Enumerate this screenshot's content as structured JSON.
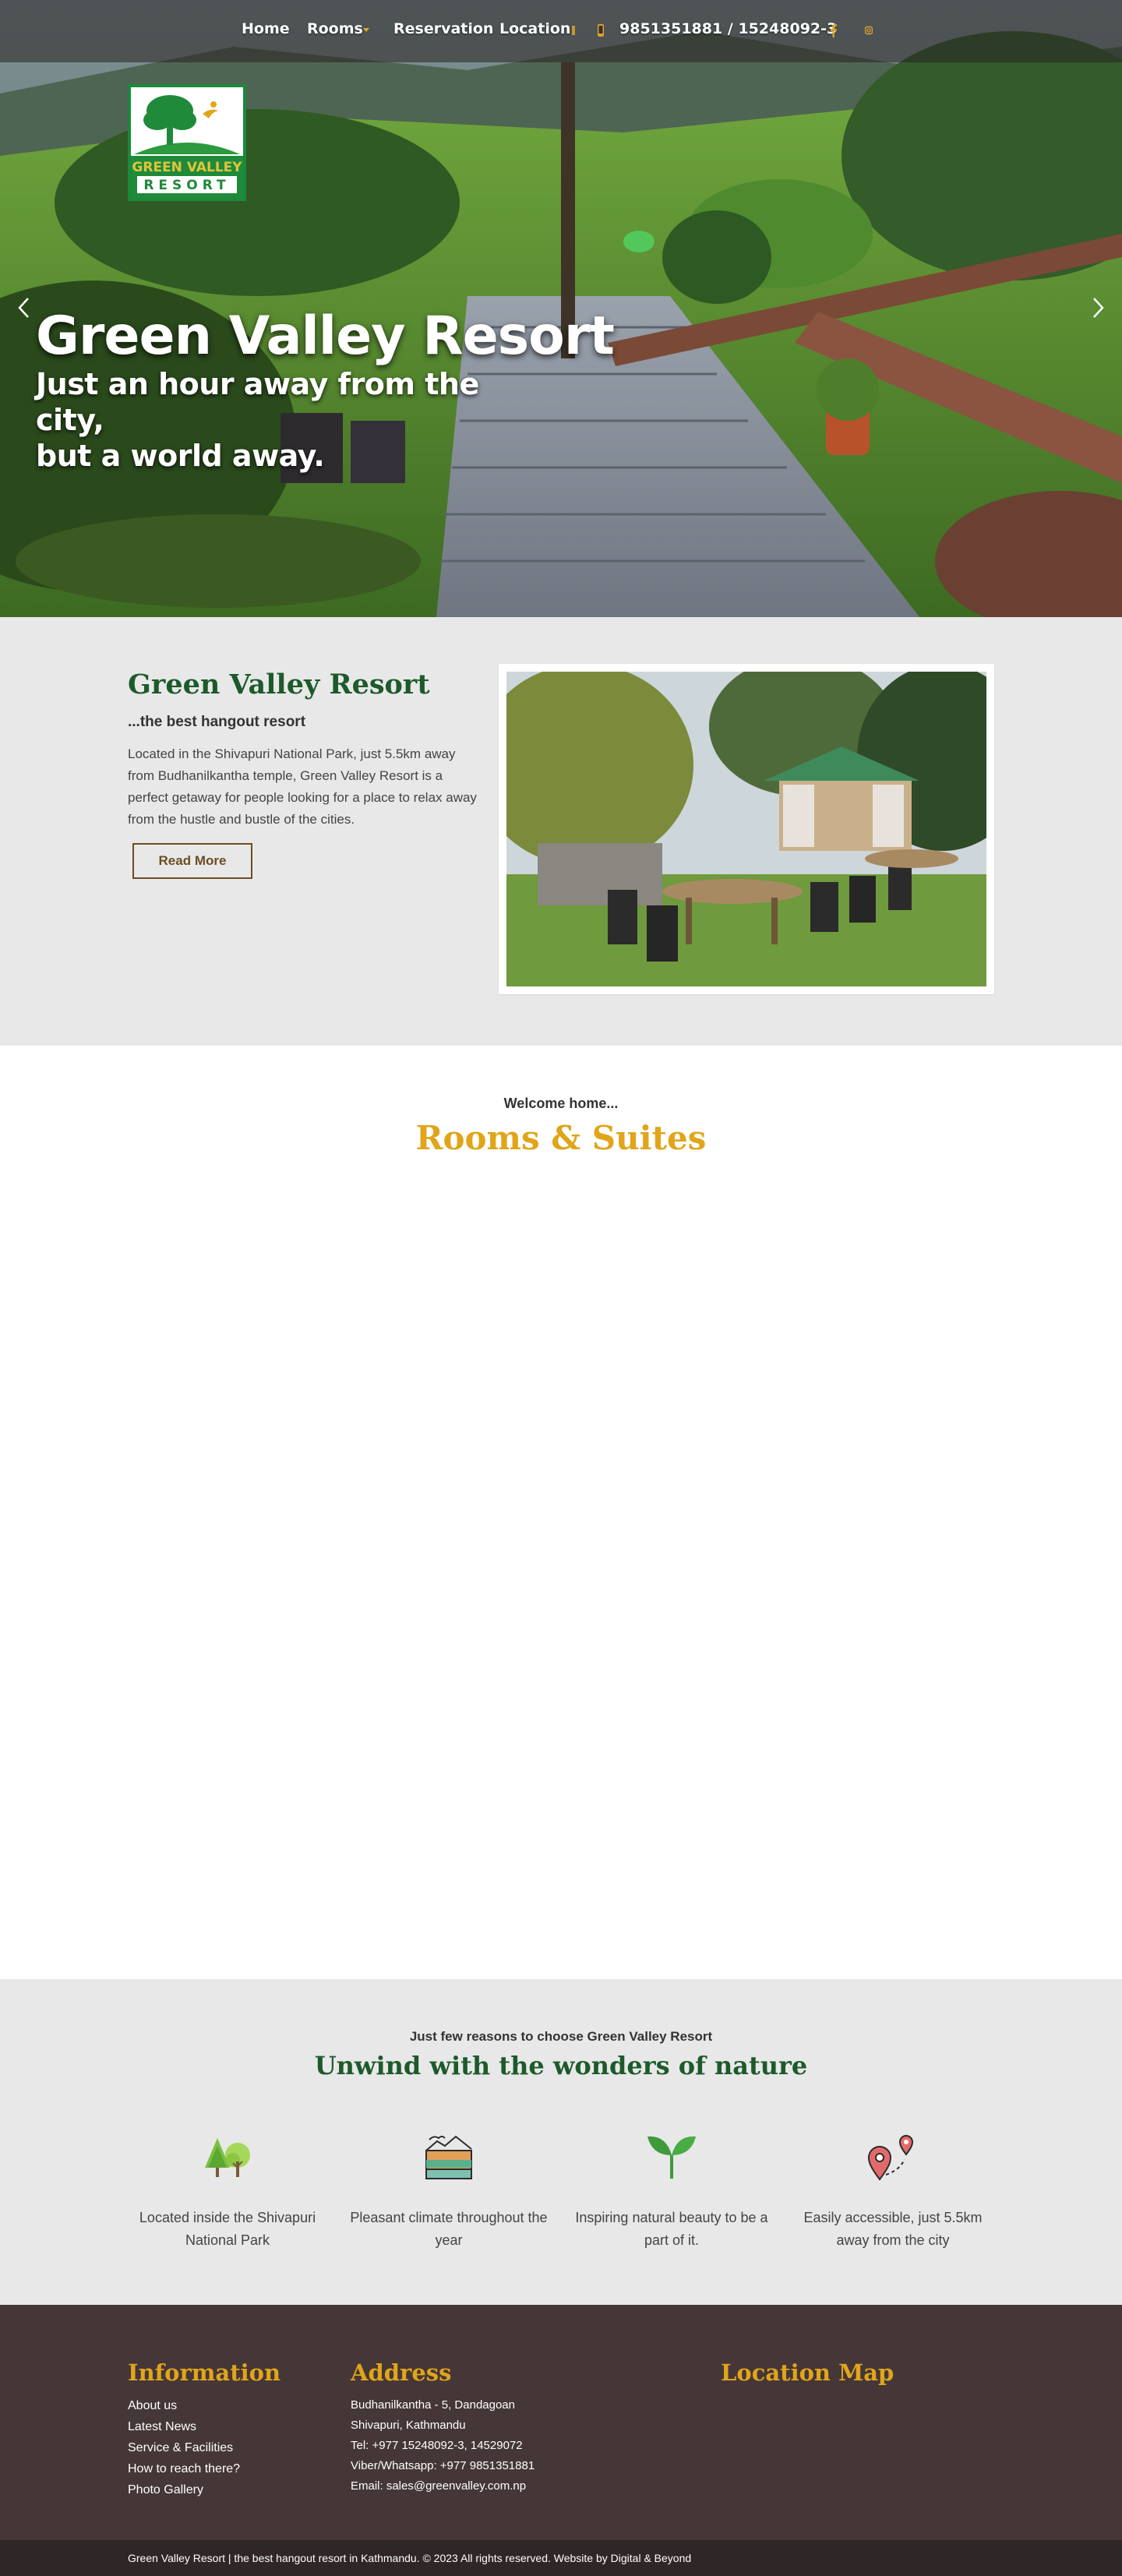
{
  "nav": {
    "items": [
      {
        "label": "Home"
      },
      {
        "label": "Rooms"
      },
      {
        "label": "Reservation"
      },
      {
        "label": "Location"
      }
    ],
    "phone": "9851351881 / 15248092-3",
    "icons": [
      "phone-icon",
      "facebook-icon",
      "instagram-icon"
    ]
  },
  "hero": {
    "logo_text_line1": "GREEN VALLEY",
    "logo_text_line2": "RESORT",
    "title": "Green Valley Resort",
    "subtitle_line1": "Just an hour away from the city,",
    "subtitle_line2": "but a world away."
  },
  "about": {
    "title": "Green Valley Resort",
    "tagline": "...the best hangout resort",
    "text": "Located in the Shivapuri National Park, just 5.5km away from Budhanilkantha temple, Green Valley Resort is a perfect getaway for people looking for a place to relax away from the hustle and bustle of the cities.",
    "button": "Read More"
  },
  "rooms": {
    "kicker": "Welcome home...",
    "title": "Rooms & Suites"
  },
  "reasons": {
    "kicker": "Just few reasons to choose Green Valley Resort",
    "title": "Unwind with the wonders of nature",
    "items": [
      {
        "icon": "trees-icon",
        "text": "Located inside the Shivapuri National Park"
      },
      {
        "icon": "climate-icon",
        "text": "Pleasant climate throughout the year"
      },
      {
        "icon": "sprout-icon",
        "text": "Inspiring natural beauty to be a part of it."
      },
      {
        "icon": "route-pin-icon",
        "text": "Easily accessible, just 5.5km away from the city"
      }
    ]
  },
  "footer": {
    "info_title": "Information",
    "info_links": [
      "About us",
      "Latest News",
      "Service & Facilities",
      "How to reach there?",
      "Photo Gallery"
    ],
    "address_title": "Address",
    "address_lines": [
      "Budhanilkantha - 5, Dandagoan",
      "Shivapuri, Kathmandu",
      "Tel: +977 15248092-3, 14529072",
      "Viber/Whatsapp: +977 9851351881",
      "Email: sales@greenvalley.com.np"
    ],
    "map_title": "Location Map",
    "copyright": "Green Valley Resort | the best hangout resort in Kathmandu. © 2023 All rights reserved. Website by Digital & Beyond"
  },
  "colors": {
    "brand_green": "#1d5a2b",
    "accent_gold": "#e0a51a",
    "footer_bg": "#453638",
    "section_gray": "#e8e8e8"
  }
}
